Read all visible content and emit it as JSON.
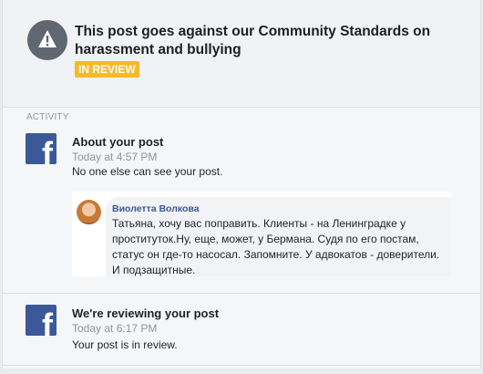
{
  "header": {
    "title": "This post goes against our Community Standards on harassment and bullying",
    "badge": "IN REVIEW",
    "icon": "warning-icon"
  },
  "activity": {
    "section_label": "ACTIVITY",
    "items": [
      {
        "icon": "facebook-icon",
        "title": "About your post",
        "time": "Today at 4:57 PM",
        "body": "No one else can see your post."
      },
      {
        "icon": "facebook-icon",
        "title": "We're reviewing your post",
        "time": "Today at 6:17 PM",
        "body": "Your post is in review."
      }
    ]
  },
  "post": {
    "author": "Виолетта Волкова",
    "text": "Татьяна, хочу вас поправить. Клиенты - на Ленинградке у проституток.Ну, еще, может, у Бермана. Судя по его постам, статус он где-то насосал. Запомните. У адвокатов - доверители. И подзащитные."
  },
  "colors": {
    "badge": "#f7b928",
    "facebook_blue": "#3b5998",
    "author_link": "#385898"
  }
}
